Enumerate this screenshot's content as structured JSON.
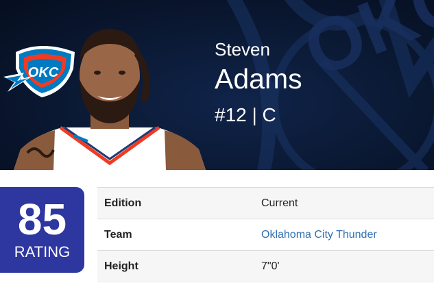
{
  "player": {
    "first_name": "Steven",
    "last_name": "Adams",
    "number_position": "#12 | C"
  },
  "team_logo": {
    "icon": "okc-thunder-logo-icon",
    "wordmark": "OKC"
  },
  "watermark": {
    "icon": "okc-watermark-icon",
    "text": "OKC"
  },
  "rating": {
    "value": "85",
    "label": "RATING",
    "color": "#2e36a0"
  },
  "info": {
    "rows": [
      {
        "label": "Edition",
        "value": "Current"
      },
      {
        "label": "Team",
        "value": "Oklahoma City Thunder"
      },
      {
        "label": "Height",
        "value": "7\"0'"
      }
    ]
  },
  "colors": {
    "hero_background": "#0b1a36",
    "thunder_blue": "#007ac1",
    "thunder_orange": "#ef3b24",
    "link": "#2f6fb3"
  }
}
